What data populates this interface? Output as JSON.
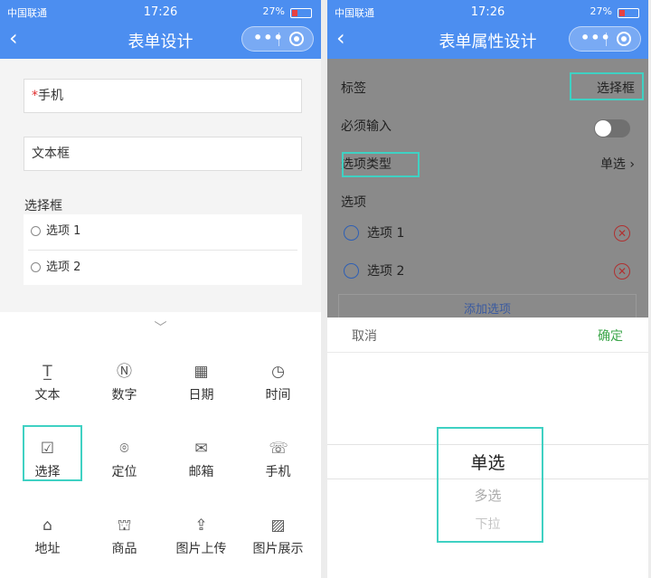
{
  "status_bar": {
    "carrier": "中国联通",
    "time": "17:26",
    "battery": "27%"
  },
  "left": {
    "title": "表单设计",
    "fields": [
      {
        "required": "*",
        "label": "手机"
      },
      {
        "label": "文本框"
      }
    ],
    "choice_label": "选择框",
    "choice_options": [
      "选项 1",
      "选项 2"
    ],
    "components": [
      {
        "icon": "text-icon",
        "label": "文本"
      },
      {
        "icon": "number-icon",
        "label": "数字"
      },
      {
        "icon": "calendar-icon",
        "label": "日期"
      },
      {
        "icon": "clock-icon",
        "label": "时间"
      },
      {
        "icon": "checkbox-icon",
        "label": "选择"
      },
      {
        "icon": "location-icon",
        "label": "定位"
      },
      {
        "icon": "mail-icon",
        "label": "邮箱"
      },
      {
        "icon": "phone-icon",
        "label": "手机"
      },
      {
        "icon": "home-icon",
        "label": "地址"
      },
      {
        "icon": "shop-icon",
        "label": "商品"
      },
      {
        "icon": "upload-icon",
        "label": "图片上传"
      },
      {
        "icon": "image-icon",
        "label": "图片展示"
      }
    ]
  },
  "right": {
    "title": "表单属性设计",
    "label_key": "标签",
    "label_value": "选择框",
    "required_key": "必须输入",
    "type_key": "选项类型",
    "type_value": "单选",
    "options_header": "选项",
    "options": [
      "选项 1",
      "选项 2"
    ],
    "add_option": "添加选项",
    "picker": {
      "cancel": "取消",
      "confirm": "确定",
      "choices": [
        "单选",
        "多选",
        "下拉"
      ]
    }
  },
  "colors": {
    "nav": "#4c8ef0",
    "highlight": "#3fd1c3",
    "confirm": "#3ca64a"
  }
}
